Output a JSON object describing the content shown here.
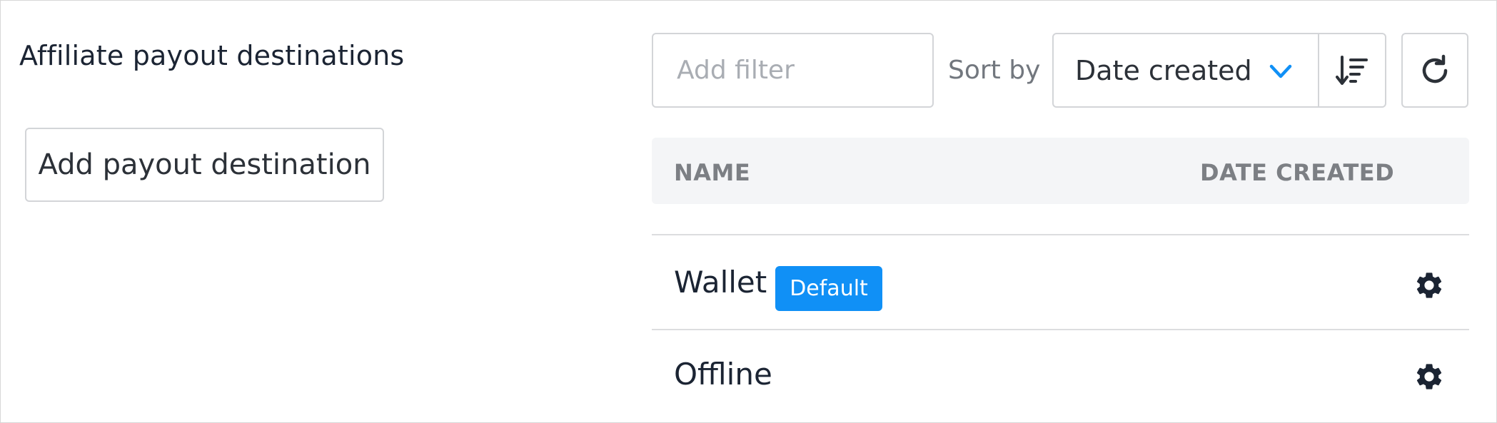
{
  "header": {
    "title": "Affiliate payout destinations",
    "add_button_label": "Add payout destination"
  },
  "toolbar": {
    "filter_placeholder": "Add filter",
    "filter_value": "",
    "sort_label": "Sort by",
    "sort_selected": "Date created",
    "sort_direction_icon": "sort-descending-icon",
    "refresh_icon": "refresh-icon"
  },
  "table": {
    "columns": [
      "NAME",
      "DATE CREATED"
    ],
    "rows": [
      {
        "name": "Wallet",
        "badge": "Default",
        "action_icon": "gear-icon"
      },
      {
        "name": "Offline",
        "badge": "",
        "action_icon": "gear-icon"
      }
    ]
  },
  "colors": {
    "accent": "#1090f6",
    "text_primary": "#1b2433",
    "header_bg": "#f4f5f7",
    "border": "#d3d5d8"
  }
}
